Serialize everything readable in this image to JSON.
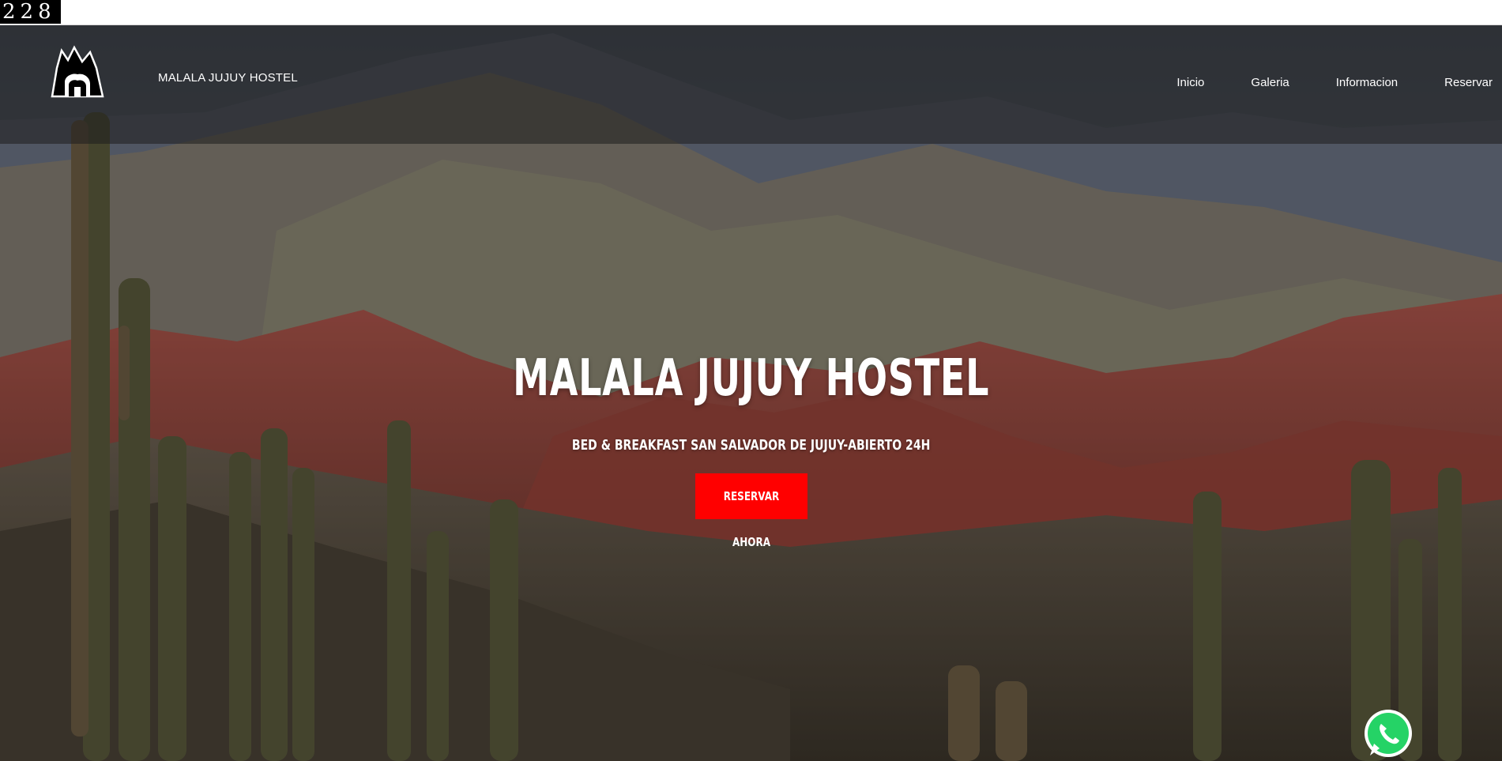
{
  "counter": "228",
  "header": {
    "brand": "MALALA JUJUY HOSTEL",
    "logo_icon": "mountain-logo-icon",
    "nav": [
      {
        "label": "Inicio"
      },
      {
        "label": "Galeria"
      },
      {
        "label": "Informacion"
      },
      {
        "label": "Reservar"
      }
    ]
  },
  "hero": {
    "title": "MALALA JUJUY HOSTEL",
    "subtitle": "BED & BREAKFAST SAN SALVADOR DE JUJUY-ABIERTO 24H",
    "cta_label": "RESERVAR AHORA",
    "cta_color": "#ff0000",
    "background": "mountain-cactus-landscape-photo"
  },
  "whatsapp": {
    "icon": "whatsapp-icon",
    "color": "#25d366"
  }
}
